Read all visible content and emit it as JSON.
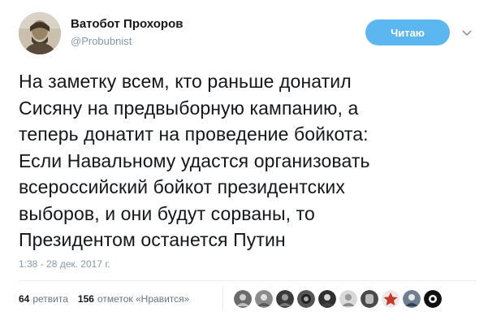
{
  "author": {
    "display_name": "Ватобот Прохоров",
    "handle": "@Probubnist",
    "avatar_icon": "user-avatar-icon"
  },
  "follow_button": {
    "label": "Читаю",
    "color": "#5cb7f0"
  },
  "tweet": {
    "lines": [
      "На заметку всем, кто раньше донатил",
      "Сисяну на предвыборную кампанию, а",
      "теперь донатит на проведение бойкота:",
      "Если Навальному удастся организовать",
      "всероссийский бойкот президентских",
      "выборов, и они будут сорваны, то",
      "Президентом останется Путин"
    ],
    "timestamp": "1:38 - 28 дек. 2017 г."
  },
  "stats": {
    "retweets_count": "64",
    "retweets_label": "ретвита",
    "likes_count": "156",
    "likes_label": "отметок «Нравится»"
  },
  "likers": [
    "liker-avatar",
    "liker-avatar",
    "liker-avatar",
    "liker-avatar",
    "liker-avatar",
    "liker-avatar",
    "liker-avatar",
    "liker-avatar",
    "liker-avatar",
    "liker-avatar"
  ]
}
